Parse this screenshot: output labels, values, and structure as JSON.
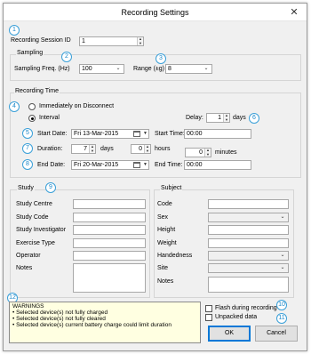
{
  "window": {
    "title": "Recording Settings",
    "close_glyph": "✕"
  },
  "badges": [
    "1",
    "2",
    "3",
    "4",
    "5",
    "6",
    "7",
    "8",
    "9",
    "10",
    "11",
    "12"
  ],
  "session": {
    "label": "Recording Session ID",
    "value": "1"
  },
  "sampling": {
    "group_title": "Sampling",
    "freq_label": "Sampling Freq. (Hz)",
    "freq_value": "100",
    "range_label": "Range (±g)",
    "range_value": "8"
  },
  "recording_time": {
    "group_title": "Recording Time",
    "immediately_label": "Immediately on Disconnect",
    "interval_label": "Interval",
    "delay_label": "Delay:",
    "delay_value": "1",
    "delay_unit": "days",
    "start_date_label": "Start Date:",
    "start_date_value": "Fri  13-Mar-2015",
    "start_time_label": "Start Time:",
    "start_time_value": "00:00",
    "duration_label": "Duration:",
    "duration_days_value": "7",
    "days_unit": "days",
    "duration_hours_value": "0",
    "hours_unit": "hours",
    "duration_minutes_value": "0",
    "minutes_unit": "minutes",
    "end_date_label": "End Date:",
    "end_date_value": "Fri  20-Mar-2015",
    "end_time_label": "End Time:",
    "end_time_value": "00:00"
  },
  "study": {
    "group_title": "Study",
    "fields": [
      "Study Centre",
      "Study Code",
      "Study Investigator",
      "Exercise Type",
      "Operator",
      "Notes"
    ]
  },
  "subject": {
    "group_title": "Subject",
    "fields": [
      "Code",
      "Sex",
      "Height",
      "Weight",
      "Handedness",
      "Site",
      "Notes"
    ]
  },
  "warnings": {
    "title": "WARNINGS",
    "items": [
      "• Selected device(s) not fully charged",
      "• Selected device(s) not fully cleared",
      "• Selected device(s) current battery charge could limit duration"
    ]
  },
  "options": {
    "flash_label": "Flash during recording",
    "unpacked_label": "Unpacked data"
  },
  "buttons": {
    "ok": "OK",
    "cancel": "Cancel"
  },
  "icons": {
    "spin": "spin-updown-icon",
    "dropdown": "chevron-down-icon",
    "calendar": "calendar-icon",
    "close": "close-icon"
  }
}
